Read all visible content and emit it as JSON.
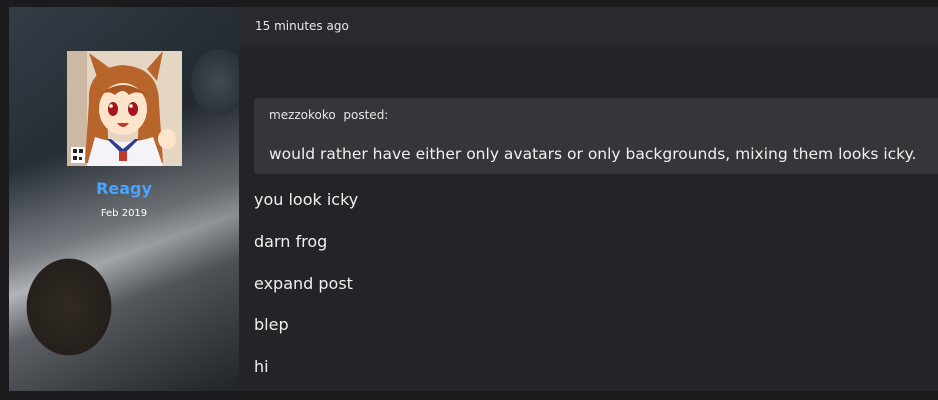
{
  "author": {
    "username": "Reagy",
    "join_date": "Feb 2019",
    "username_color": "#4aa3ff"
  },
  "post": {
    "timestamp": "15 minutes ago",
    "quote": {
      "author": "mezzokoko",
      "posted_label": "posted:",
      "text": "would rather have either only avatars or only backgrounds, mixing them looks icky."
    },
    "lines": [
      "you look icky",
      "darn frog",
      "expand post",
      "blep",
      "hi"
    ]
  }
}
